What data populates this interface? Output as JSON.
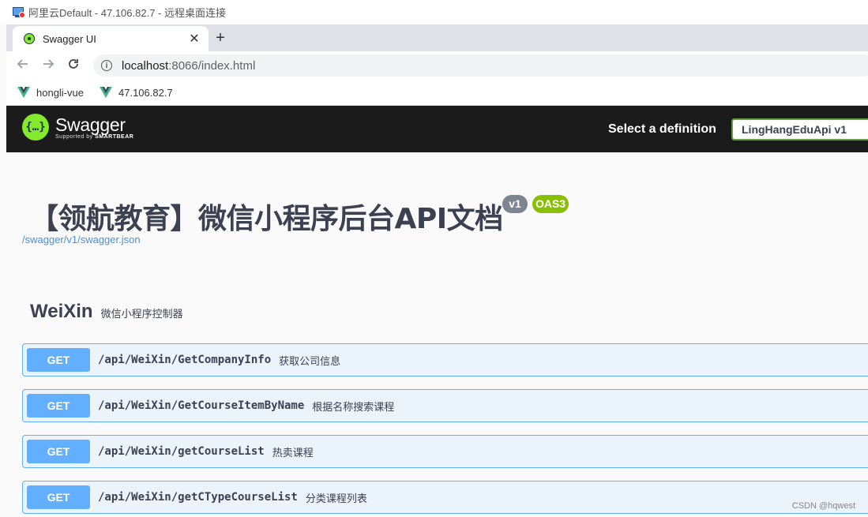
{
  "window": {
    "title": "阿里云Default - 47.106.82.7 - 远程桌面连接"
  },
  "browser": {
    "tab": {
      "title": "Swagger UI",
      "close": "✕"
    },
    "new_tab": "+",
    "address": {
      "host": "localhost",
      "rest": ":8066/index.html"
    },
    "bookmarks": [
      {
        "label": "hongli-vue"
      },
      {
        "label": "47.106.82.7"
      }
    ]
  },
  "swagger": {
    "logo": {
      "glyph": "{…}",
      "name": "Swagger",
      "tagline_prefix": "Supported by",
      "tagline_brand": "SMARTBEAR"
    },
    "select_label": "Select a definition",
    "selected_definition": "LingHangEduApi v1",
    "api_title": "【领航教育】微信小程序后台API文档",
    "version_badge": "v1",
    "oas_badge": "OAS3",
    "spec_url": "/swagger/v1/swagger.json",
    "tag": {
      "name": "WeiXin",
      "description": "微信小程序控制器"
    },
    "operations": [
      {
        "method": "GET",
        "path": "/api/WeiXin/GetCompanyInfo",
        "summary": "获取公司信息"
      },
      {
        "method": "GET",
        "path": "/api/WeiXin/GetCourseItemByName",
        "summary": "根据名称搜索课程"
      },
      {
        "method": "GET",
        "path": "/api/WeiXin/getCourseList",
        "summary": "热卖课程"
      },
      {
        "method": "GET",
        "path": "/api/WeiXin/getCTypeCourseList",
        "summary": "分类课程列表"
      }
    ],
    "colors": {
      "get": "#61affe",
      "get_bg": "#ebf3fb",
      "accent": "#85ea2d",
      "topbar": "#1b1b1b"
    }
  },
  "watermark": "CSDN @hqwest"
}
